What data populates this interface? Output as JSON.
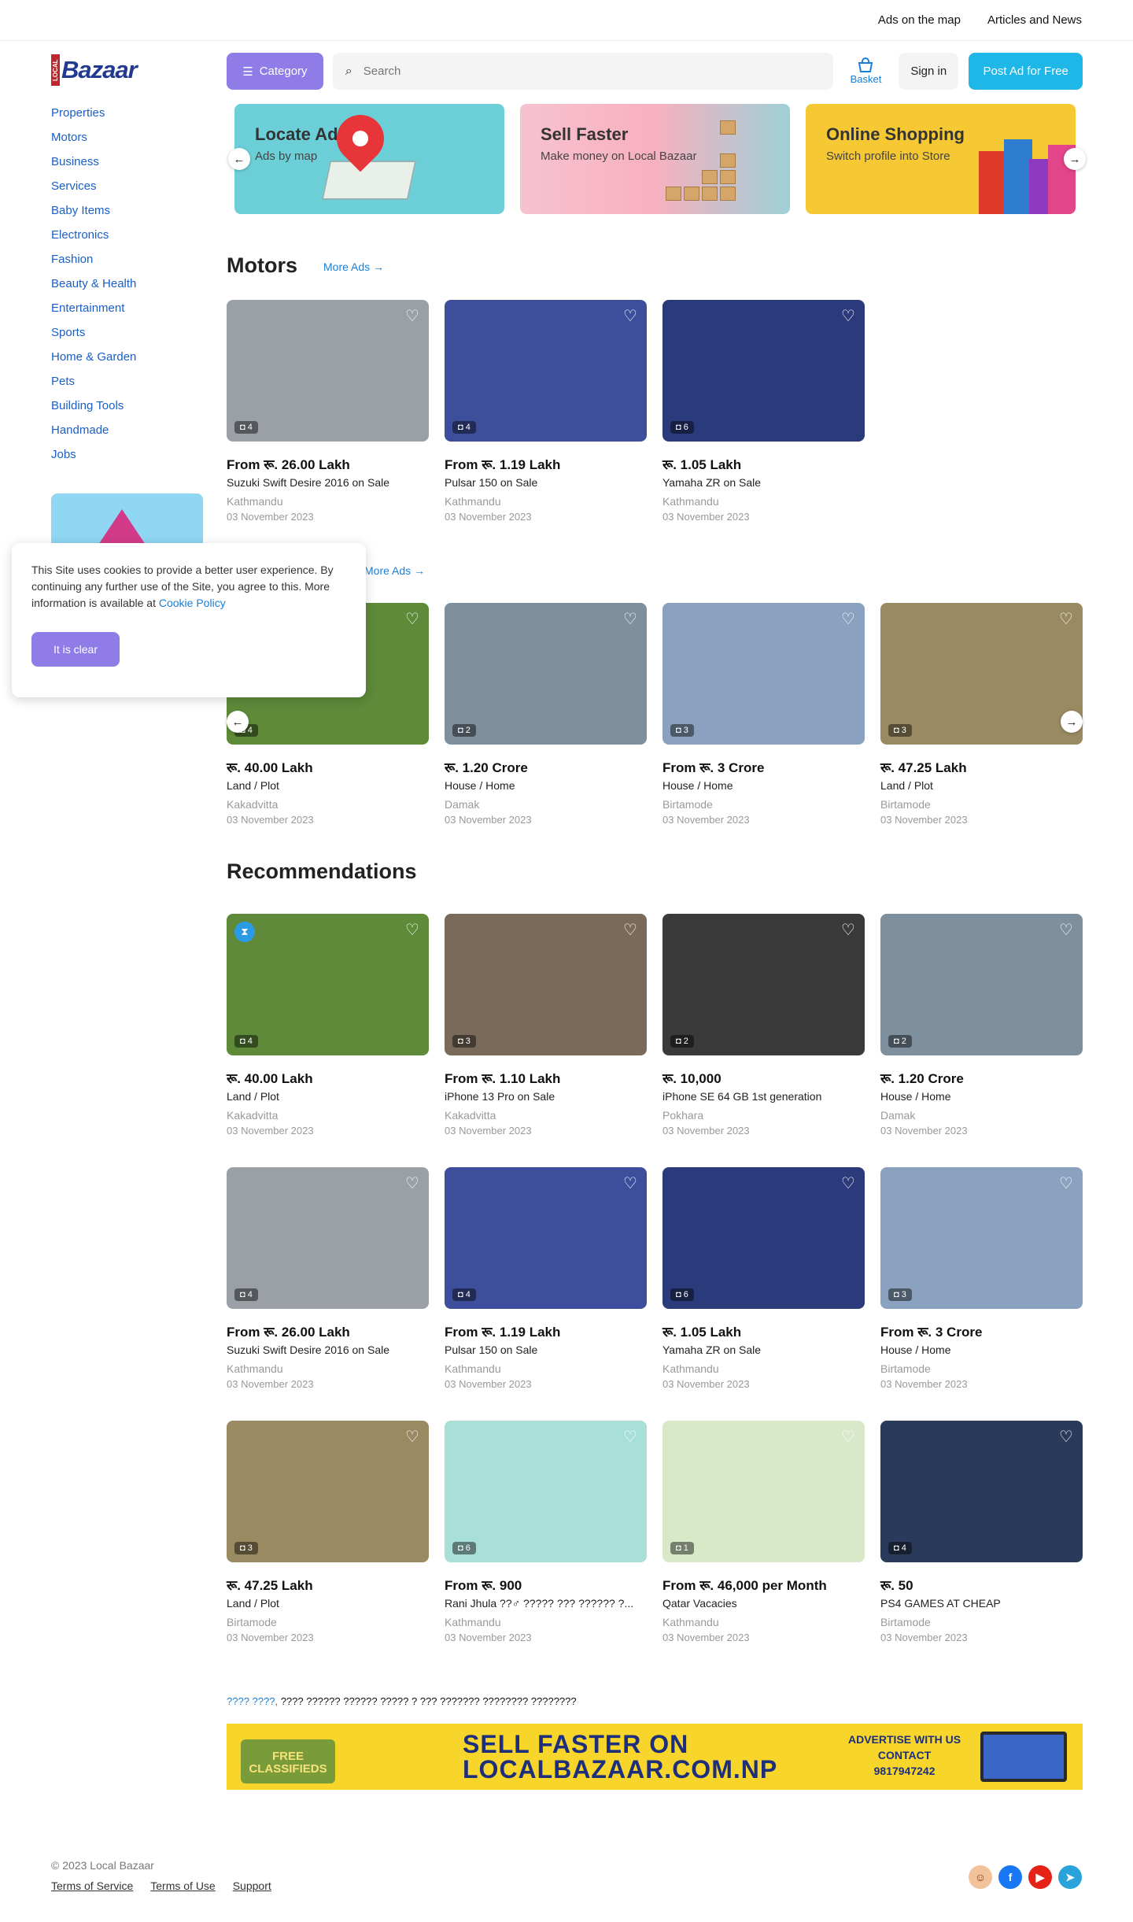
{
  "topbar": {
    "ads_on_map": "Ads on the map",
    "articles": "Articles and News"
  },
  "logo": {
    "small": "LOCAL",
    "brand": "Bazaar"
  },
  "categories": [
    "Properties",
    "Motors",
    "Business",
    "Services",
    "Baby Items",
    "Electronics",
    "Fashion",
    "Beauty & Health",
    "Entertainment",
    "Sports",
    "Home & Garden",
    "Pets",
    "Building Tools",
    "Handmade",
    "Jobs"
  ],
  "header": {
    "category_label": "Category",
    "search_placeholder": "Search",
    "basket_label": "Basket",
    "signin_label": "Sign in",
    "post_label": "Post Ad for Free"
  },
  "banners": [
    {
      "title": "Locate Ad.",
      "subtitle": "Ads by map"
    },
    {
      "title": "Sell Faster",
      "subtitle": "Make money on Local Bazaar"
    },
    {
      "title": "Online Shopping",
      "subtitle": "Switch profile into Store"
    }
  ],
  "motors": {
    "title": "Motors",
    "more": "More Ads →",
    "items": [
      {
        "price": "From रू. 26.00 Lakh",
        "title": "Suzuki Swift Desire 2016 on Sale",
        "location": "Kathmandu",
        "date": "03 November 2023",
        "count": "4",
        "color": "#9aa0a6"
      },
      {
        "price": "From रू. 1.19 Lakh",
        "title": "Pulsar 150 on Sale",
        "location": "Kathmandu",
        "date": "03 November 2023",
        "count": "4",
        "color": "#3d4f9c"
      },
      {
        "price": "रू. 1.05 Lakh",
        "title": "Yamaha ZR on Sale",
        "location": "Kathmandu",
        "date": "03 November 2023",
        "count": "6",
        "color": "#2b3a7a"
      }
    ]
  },
  "properties": {
    "more": "More Ads →",
    "items": [
      {
        "price": "रू. 40.00 Lakh",
        "title": "Land / Plot",
        "location": "Kakadvitta",
        "date": "03 November 2023",
        "count": "4",
        "color": "#5e8a3a"
      },
      {
        "price": "रू. 1.20 Crore",
        "title": "House / Home",
        "location": "Damak",
        "date": "03 November 2023",
        "count": "2",
        "color": "#7e8f9e"
      },
      {
        "price": "From रू. 3 Crore",
        "title": "House / Home",
        "location": "Birtamode",
        "date": "03 November 2023",
        "count": "3",
        "color": "#8aa2bf"
      },
      {
        "price": "रू. 47.25 Lakh",
        "title": "Land / Plot",
        "location": "Birtamode",
        "date": "03 November 2023",
        "count": "3",
        "color": "#9a8a62"
      }
    ]
  },
  "recommendations": {
    "title": "Recommendations",
    "items": [
      {
        "price": "रू. 40.00 Lakh",
        "title": "Land / Plot",
        "location": "Kakadvitta",
        "date": "03 November 2023",
        "count": "4",
        "color": "#5e8a3a"
      },
      {
        "price": "From रू. 1.10 Lakh",
        "title": "iPhone 13 Pro on Sale",
        "location": "Kakadvitta",
        "date": "03 November 2023",
        "count": "3",
        "color": "#7a6a5a"
      },
      {
        "price": "रू. 10,000",
        "title": "iPhone SE 64 GB 1st generation",
        "location": "Pokhara",
        "date": "03 November 2023",
        "count": "2",
        "color": "#3a3a3a"
      },
      {
        "price": "रू. 1.20 Crore",
        "title": "House / Home",
        "location": "Damak",
        "date": "03 November 2023",
        "count": "2",
        "color": "#7e8f9e"
      },
      {
        "price": "From रू. 26.00 Lakh",
        "title": "Suzuki Swift Desire 2016 on Sale",
        "location": "Kathmandu",
        "date": "03 November 2023",
        "count": "4",
        "color": "#9aa0a6"
      },
      {
        "price": "From रू. 1.19 Lakh",
        "title": "Pulsar 150 on Sale",
        "location": "Kathmandu",
        "date": "03 November 2023",
        "count": "4",
        "color": "#3d4f9c"
      },
      {
        "price": "रू. 1.05 Lakh",
        "title": "Yamaha ZR on Sale",
        "location": "Kathmandu",
        "date": "03 November 2023",
        "count": "6",
        "color": "#2b3a7a"
      },
      {
        "price": "From रू. 3 Crore",
        "title": "House / Home",
        "location": "Birtamode",
        "date": "03 November 2023",
        "count": "3",
        "color": "#8aa2bf"
      },
      {
        "price": "रू. 47.25 Lakh",
        "title": "Land / Plot",
        "location": "Birtamode",
        "date": "03 November 2023",
        "count": "3",
        "color": "#9a8a62"
      },
      {
        "price": "From रू. 900",
        "title": "Rani Jhula ??♂ ????? ??? ?????? ?...",
        "location": "Kathmandu",
        "date": "03 November 2023",
        "count": "6",
        "color": "#a8e0d8"
      },
      {
        "price": "From रू. 46,000 per Month",
        "title": "Qatar Vacacies",
        "location": "Kathmandu",
        "date": "03 November 2023",
        "count": "1",
        "color": "#d8e8c8"
      },
      {
        "price": "रू. 50",
        "title": "PS4 GAMES AT CHEAP",
        "location": "Birtamode",
        "date": "03 November 2023",
        "count": "4",
        "color": "#2a3a5a"
      }
    ]
  },
  "cookie": {
    "text": "This Site uses cookies to provide a better user experience. By continuing any further use of the Site, you agree to this. More information is available at ",
    "link": "Cookie Policy",
    "button": "It is clear"
  },
  "seo": {
    "link": "???? ????,",
    "text": " ???? ?????? ?????? ????? ? ??? ??????? ???????? ????????"
  },
  "ad_strip": {
    "free": "FREE CLASSIFIEDS",
    "line1": "SELL FASTER ON",
    "line2": "LOCALBAZAAR.COM.NP",
    "contact1": "ADVERTISE WITH US",
    "contact2": "CONTACT",
    "phone": "9817947242"
  },
  "footer": {
    "copyright": "© 2023 Local Bazaar",
    "terms_service": "Terms of Service",
    "terms_use": "Terms of Use",
    "support": "Support"
  },
  "colors": {
    "accent_purple": "#8f7ce6",
    "accent_blue": "#1fb6e8",
    "link_blue": "#1a7fd6",
    "facebook": "#1877f2",
    "youtube": "#e62117",
    "telegram": "#2aa3db"
  }
}
